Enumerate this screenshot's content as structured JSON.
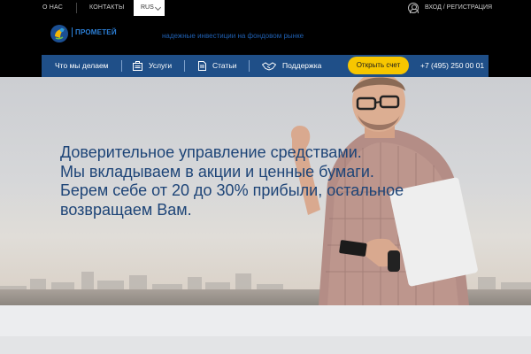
{
  "topbar": {
    "about": "О НАС",
    "contacts": "КОНТАКТЫ",
    "language": "RUS",
    "login": "ВХОД / РЕГИСТРАЦИЯ"
  },
  "header": {
    "logo_text": "ПРОМЕТЕЙ",
    "tagline": "надежные инвестиции на фондовом рынке"
  },
  "nav": {
    "items": [
      {
        "label": "Что мы делаем",
        "icon": "none"
      },
      {
        "label": "Услуги",
        "icon": "briefcase-icon"
      },
      {
        "label": "Статьи",
        "icon": "document-icon"
      },
      {
        "label": "Поддержка",
        "icon": "handshake-icon"
      }
    ],
    "cta": "Открыть счет",
    "phone": "+7 (495) 250 00 01"
  },
  "hero": {
    "lines": [
      "Доверительное управление средствами.",
      "Мы вкладываем в акции и ценные бумаги.",
      "Берем себе от 20 до 30% прибыли, остальное",
      "возвращаем Вам."
    ]
  },
  "colors": {
    "nav_bg": "#1f4f88",
    "cta_bg": "#f7c600",
    "hero_text": "#1d4477",
    "brand_blue": "#2c7fd6"
  }
}
